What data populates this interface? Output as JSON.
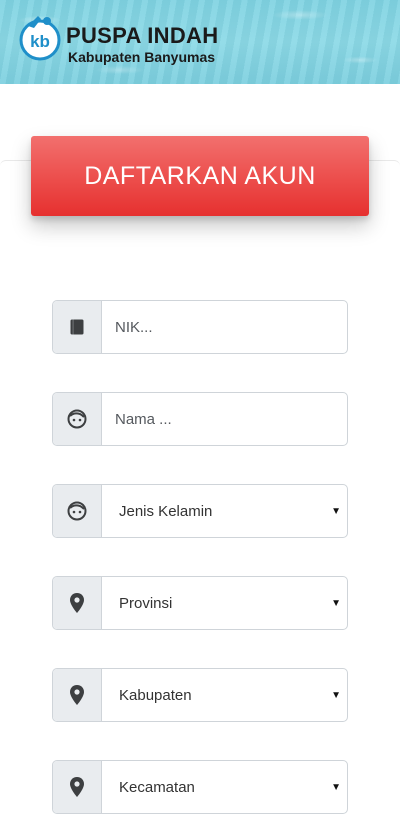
{
  "header": {
    "brand_title": "PUSPA INDAH",
    "brand_subtitle": "Kabupaten Banyumas",
    "logo_text": "kb"
  },
  "form": {
    "title": "DAFTARKAN AKUN",
    "nik": {
      "placeholder": "NIK...",
      "icon": "book-icon"
    },
    "nama": {
      "placeholder": "Nama ...",
      "icon": "face-icon"
    },
    "jenis_kelamin": {
      "selected": "Jenis Kelamin",
      "icon": "face-icon"
    },
    "provinsi": {
      "selected": "Provinsi",
      "icon": "map-pin-icon"
    },
    "kabupaten": {
      "selected": "Kabupaten",
      "icon": "map-pin-icon"
    },
    "kecamatan": {
      "selected": "Kecamatan",
      "icon": "map-pin-icon"
    }
  },
  "colors": {
    "header_bg": "#8bd9e6",
    "title_button": "#ec4d4b",
    "addon_bg": "#e9ecef",
    "icon": "#3d3f41"
  }
}
